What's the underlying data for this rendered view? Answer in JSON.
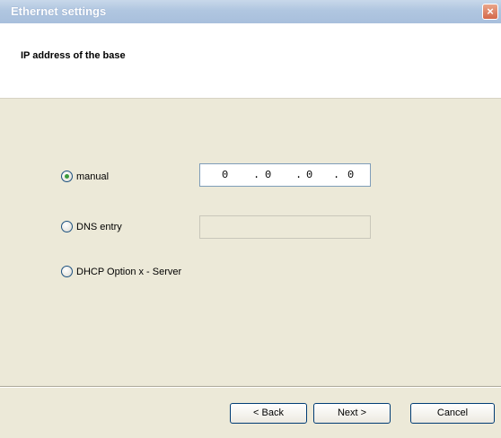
{
  "window": {
    "title": "Ethernet settings",
    "close_label": "×"
  },
  "header": {
    "title": "IP address of the base"
  },
  "options": {
    "manual": {
      "label": "manual",
      "checked": true
    },
    "dns": {
      "label": "DNS entry",
      "checked": false
    },
    "dhcp": {
      "label": "DHCP Option x - Server",
      "checked": false
    }
  },
  "ip_address": {
    "octets": [
      "0",
      "0",
      "0",
      "0"
    ],
    "separator": "."
  },
  "dns_field": {
    "value": "",
    "enabled": false
  },
  "buttons": {
    "back": "< Back",
    "next": "Next >",
    "cancel": "Cancel"
  },
  "colors": {
    "titlebar": "#b0c6e0",
    "dialog_bg": "#ece9d8",
    "radio_dot": "#3c9a3c"
  }
}
